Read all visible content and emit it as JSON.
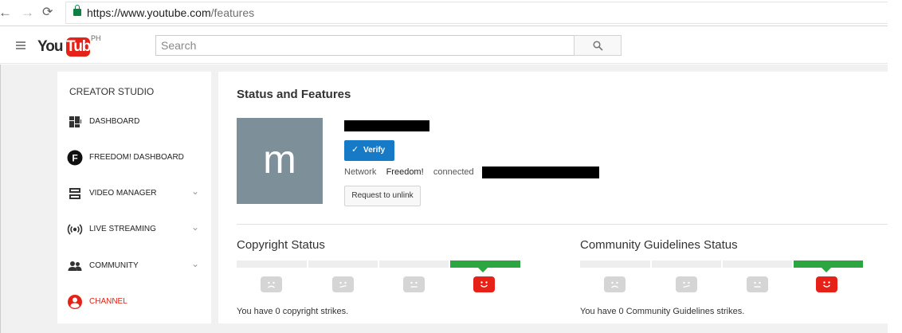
{
  "browser": {
    "url_host": "https://www.youtube.com",
    "url_path": "/features"
  },
  "masthead": {
    "logo_you": "You",
    "logo_tube": "Tube",
    "country": "PH",
    "search_placeholder": "Search"
  },
  "sidebar": {
    "heading": "CREATOR STUDIO",
    "items": [
      {
        "label": "DASHBOARD",
        "icon": "dashboard-icon",
        "expandable": false
      },
      {
        "label": "FREEDOM! DASHBOARD",
        "icon": "freedom-icon",
        "expandable": false
      },
      {
        "label": "VIDEO MANAGER",
        "icon": "video-manager-icon",
        "expandable": true
      },
      {
        "label": "LIVE STREAMING",
        "icon": "live-streaming-icon",
        "expandable": true
      },
      {
        "label": "COMMUNITY",
        "icon": "community-icon",
        "expandable": true
      },
      {
        "label": "CHANNEL",
        "icon": "channel-icon",
        "expandable": false,
        "active": true
      }
    ]
  },
  "main": {
    "title": "Status and Features",
    "avatar_letter": "m",
    "verify_label": "Verify",
    "network_label": "Network",
    "network_value": "Freedom!",
    "connected_label": "connected",
    "unlink_label": "Request to unlink",
    "copyright": {
      "title": "Copyright Status",
      "message": "You have 0 copyright strikes.",
      "active_level": 4
    },
    "community": {
      "title": "Community Guidelines Status",
      "message": "You have 0 Community Guidelines strikes.",
      "active_level": 4
    }
  },
  "colors": {
    "accent_red": "#e62117",
    "good_green": "#2ba640",
    "verify_blue": "#167ac6",
    "avatar_bg": "#7d8f99"
  }
}
